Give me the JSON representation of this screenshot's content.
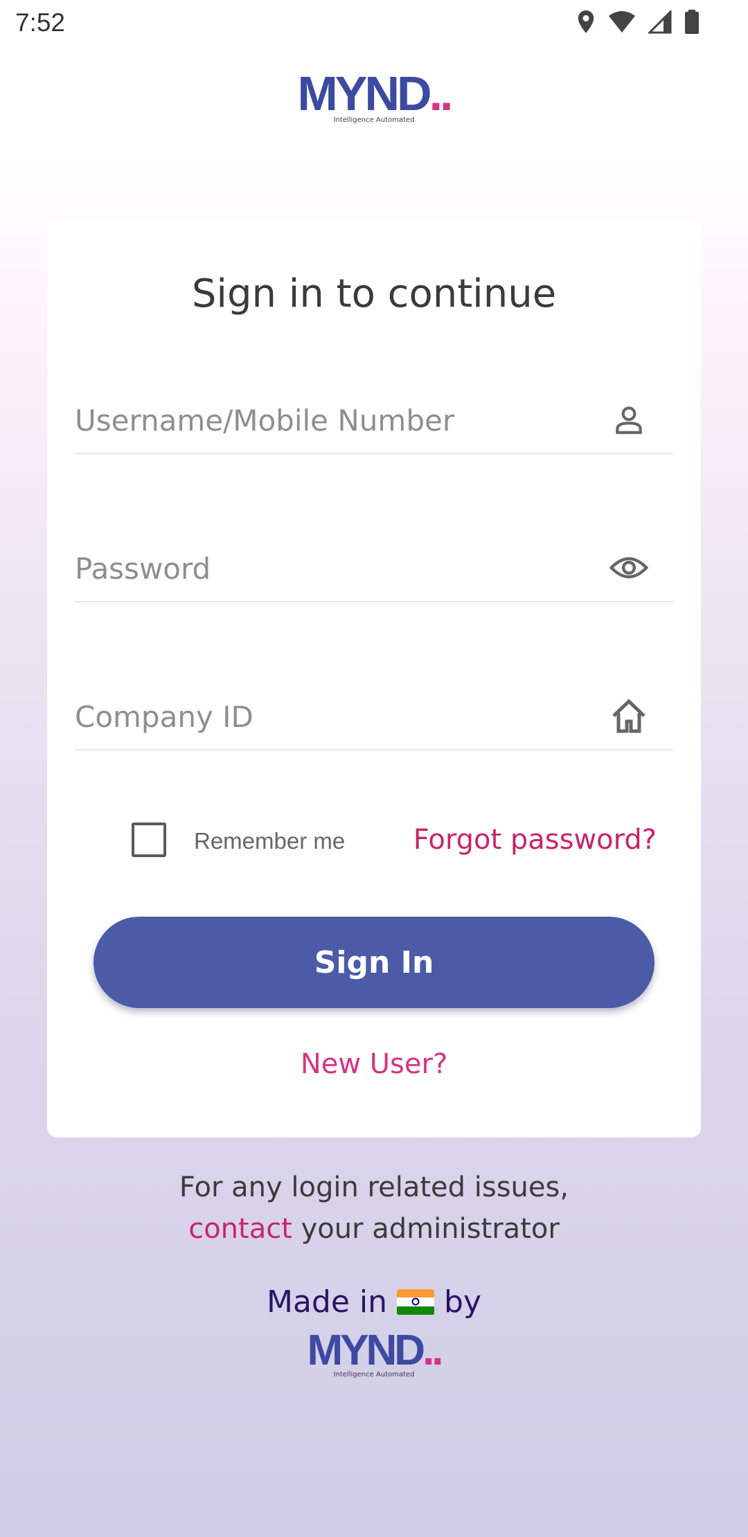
{
  "status_bar": {
    "time": "7:52",
    "icons": [
      "location-icon",
      "wifi-icon",
      "signal-icon",
      "battery-icon"
    ]
  },
  "logo": {
    "brand": "MYND",
    "dots": "..",
    "tagline": "Intelligence Automated"
  },
  "login": {
    "title": "Sign in to continue",
    "username_placeholder": "Username/Mobile Number",
    "username_value": "",
    "password_placeholder": "Password",
    "password_value": "",
    "company_placeholder": "Company ID",
    "company_value": "",
    "remember_label": "Remember me",
    "remember_checked": false,
    "forgot_label": "Forgot password?",
    "signin_label": "Sign In",
    "new_user_label": "New User?"
  },
  "footer": {
    "issues_line1": "For any login related issues,",
    "contact_label": "contact",
    "issues_line2_rest": " your administrator",
    "made_in": "Made in",
    "by": "by"
  },
  "colors": {
    "primary": "#4b5ba8",
    "accent": "#c8246b",
    "brand_blue": "#3d4aa1",
    "brand_pink": "#d63384"
  }
}
